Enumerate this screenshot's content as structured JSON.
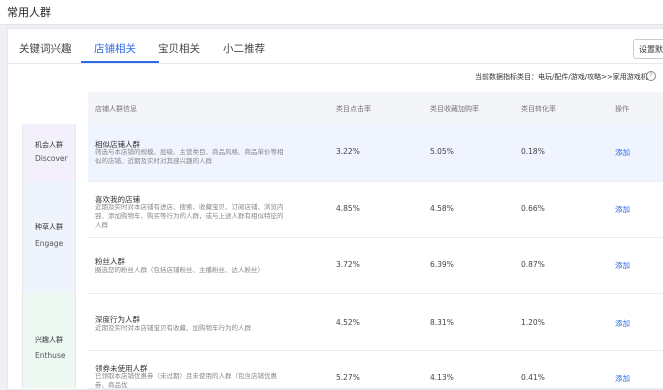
{
  "page_title": "常用人群",
  "tabs": [
    {
      "label": "关键词兴趣"
    },
    {
      "label": "店铺相关"
    },
    {
      "label": "宝贝相关"
    },
    {
      "label": "小二推荐"
    }
  ],
  "active_tab": 1,
  "settings_button": "设置默认",
  "metric_category": "当前数据指标类目：电玩/配件/游戏/攻略>>家用游戏机",
  "table": {
    "headers": [
      "店铺人群信息",
      "类目点击率",
      "类目收藏加购率",
      "类目转化率",
      "操作"
    ]
  },
  "categories": [
    {
      "cn": "机会人群",
      "en": "Discover",
      "color": "#f3effb"
    },
    {
      "cn": "种草人群",
      "en": "Engage",
      "color": "#eef3fc"
    },
    {
      "cn": "兴趣人群",
      "en": "Enthuse",
      "color": "#edf8f3"
    }
  ],
  "rows": [
    {
      "title": "相似店铺人群",
      "desc": "筛选与本店铺的规模、层级、主营类目、商品风格、商品单价等相似的店铺、近期及实时对其感兴趣的人群",
      "ctr": "3.22%",
      "fav": "5.05%",
      "cvr": "0.18%",
      "op": "添加"
    },
    {
      "title": "喜欢我的店铺",
      "desc": "近期及实时对本店铺有进店、搜索、收藏宝贝、订阅店铺、浏览内容、添加购物车、购买等行为的人群，或与上述人群有相似特征的人群",
      "ctr": "4.85%",
      "fav": "4.58%",
      "cvr": "0.66%",
      "op": "添加"
    },
    {
      "title": "粉丝人群",
      "desc": "圈选您的粉丝人群（包括店铺粉丝、主播粉丝、达人粉丝）",
      "ctr": "3.72%",
      "fav": "6.39%",
      "cvr": "0.87%",
      "op": "添加"
    },
    {
      "title": "深度行为人群",
      "desc": "近期及实时对本店铺宝贝有收藏、加购物车行为的人群",
      "ctr": "4.52%",
      "fav": "8.31%",
      "cvr": "1.20%",
      "op": "添加"
    },
    {
      "title": "领券未使用人群",
      "desc": "已领取本店铺优惠券（未过期）且未使用的人群（包含店铺优惠券、商品优",
      "ctr": "5.27%",
      "fav": "4.13%",
      "cvr": "0.41%",
      "op": "添加"
    }
  ]
}
